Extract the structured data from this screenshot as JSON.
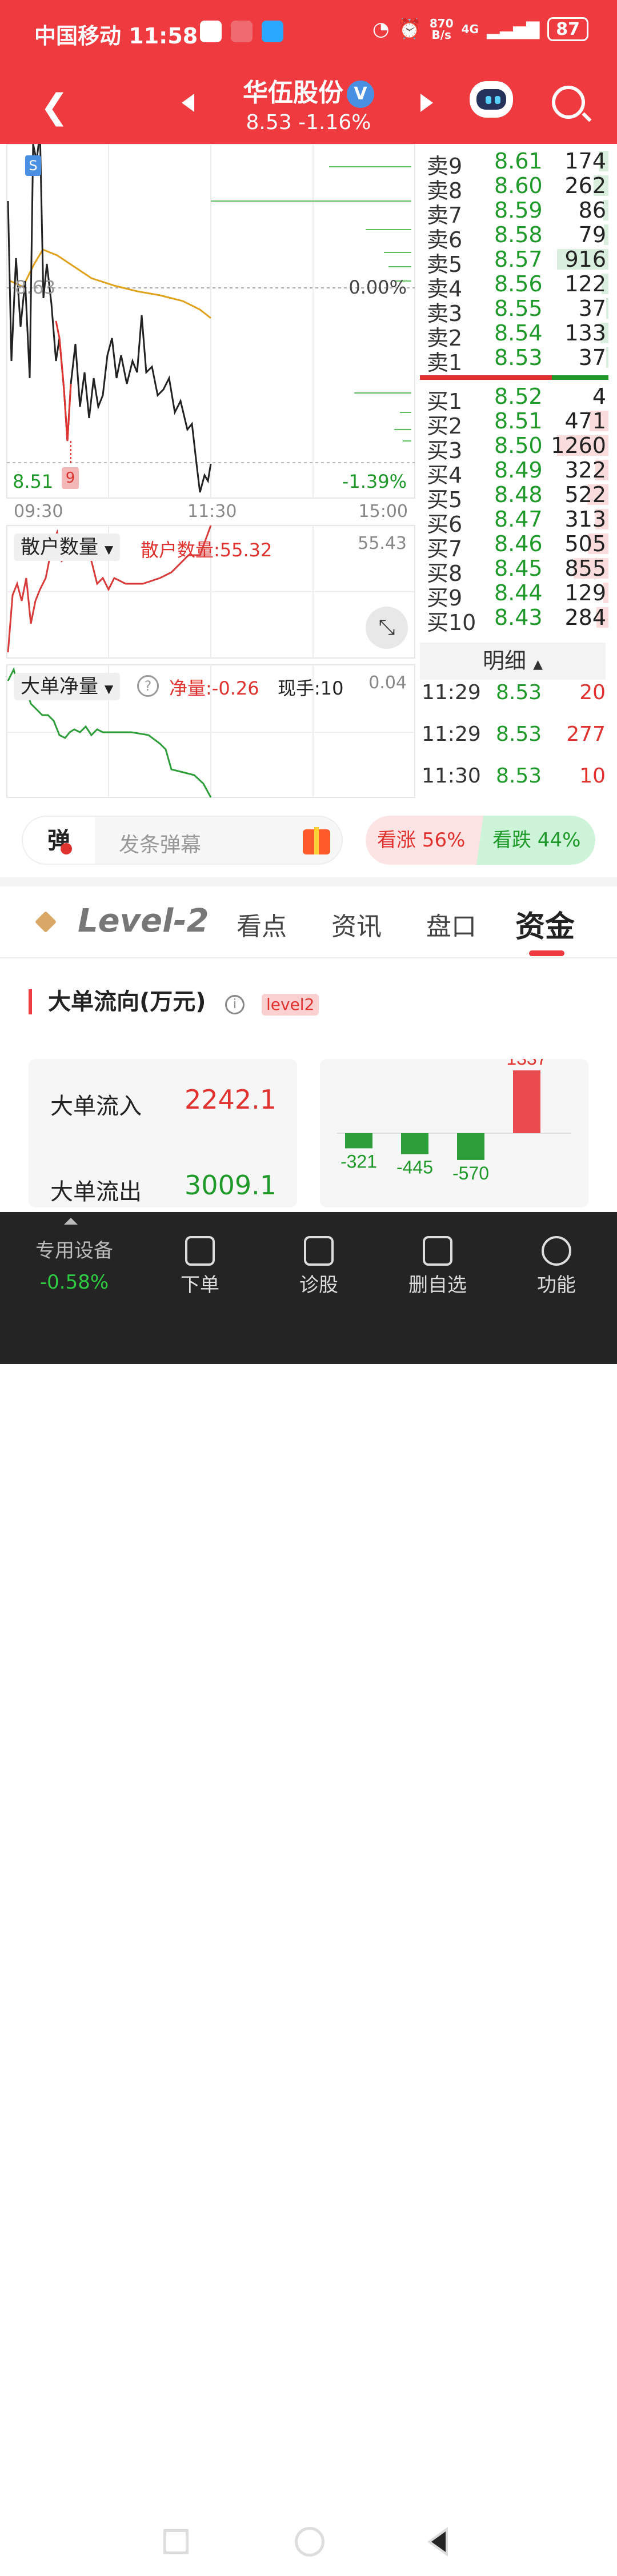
{
  "status_bar": {
    "carrier": "中国移动",
    "time": "11:58",
    "speed_value": "870",
    "speed_unit": "B/s",
    "network": "4G",
    "battery": "87"
  },
  "header": {
    "stock_name": "华伍股份",
    "verified_badge": "V",
    "price_line": "8.53 -1.16%",
    "back_icon": "chevron-left-icon",
    "prev_icon": "triangle-left-icon",
    "next_icon": "triangle-right-icon",
    "robot_icon": "robot-icon",
    "search_icon": "search-icon"
  },
  "chart": {
    "top_marker": "S",
    "ref_price": "8.63",
    "ref_pct": "0.00%",
    "low_price": "8.51",
    "low_marker": "9",
    "low_pct": "-1.39%",
    "times": [
      "09:30",
      "11:30",
      "15:00"
    ],
    "retail": {
      "selector": "散户数量",
      "label": "散户数量:55.32",
      "max": "55.43"
    },
    "bigorder": {
      "selector": "大单净量",
      "net_label": "净量:-0.26",
      "hand_label": "现手:10",
      "max": "0.04"
    },
    "expand_icon": "expand-icon",
    "help_icon": "question-icon"
  },
  "orderbook": {
    "asks": [
      {
        "name": "卖9",
        "price": "8.61",
        "vol": "174",
        "ratio": 0.19
      },
      {
        "name": "卖8",
        "price": "8.60",
        "vol": "262",
        "ratio": 0.29
      },
      {
        "name": "卖7",
        "price": "8.59",
        "vol": "86",
        "ratio": 0.1
      },
      {
        "name": "卖6",
        "price": "8.58",
        "vol": "79",
        "ratio": 0.09
      },
      {
        "name": "卖5",
        "price": "8.57",
        "vol": "916",
        "ratio": 1.0
      },
      {
        "name": "卖4",
        "price": "8.56",
        "vol": "122",
        "ratio": 0.13
      },
      {
        "name": "卖3",
        "price": "8.55",
        "vol": "37",
        "ratio": 0.04
      },
      {
        "name": "卖2",
        "price": "8.54",
        "vol": "133",
        "ratio": 0.15
      },
      {
        "name": "卖1",
        "price": "8.53",
        "vol": "37",
        "ratio": 0.04
      }
    ],
    "bids": [
      {
        "name": "买1",
        "price": "8.52",
        "vol": "4",
        "ratio": 0.0
      },
      {
        "name": "买2",
        "price": "8.51",
        "vol": "471",
        "ratio": 0.37
      },
      {
        "name": "买3",
        "price": "8.50",
        "vol": "1260",
        "ratio": 1.0
      },
      {
        "name": "买4",
        "price": "8.49",
        "vol": "322",
        "ratio": 0.26
      },
      {
        "name": "买5",
        "price": "8.48",
        "vol": "522",
        "ratio": 0.41
      },
      {
        "name": "买6",
        "price": "8.47",
        "vol": "313",
        "ratio": 0.25
      },
      {
        "name": "买7",
        "price": "8.46",
        "vol": "505",
        "ratio": 0.4
      },
      {
        "name": "买8",
        "price": "8.45",
        "vol": "855",
        "ratio": 0.68
      },
      {
        "name": "买9",
        "price": "8.44",
        "vol": "129",
        "ratio": 0.1
      },
      {
        "name": "买10",
        "price": "8.43",
        "vol": "284",
        "ratio": 0.23
      }
    ],
    "detail_label": "明细",
    "details": [
      {
        "time": "11:29",
        "price": "8.53",
        "vol": "20"
      },
      {
        "time": "11:29",
        "price": "8.53",
        "vol": "277"
      },
      {
        "time": "11:30",
        "price": "8.53",
        "vol": "10"
      }
    ]
  },
  "danmu": {
    "button": "弹",
    "placeholder": "发条弹幕",
    "gift_icon": "gift-icon"
  },
  "vote": {
    "up": "看涨 56%",
    "down": "看跌 44%"
  },
  "tabs": {
    "level": "Level-2",
    "items": [
      "看点",
      "资讯",
      "盘口",
      "资金"
    ],
    "active": "资金"
  },
  "capital": {
    "title": "大单流向(万元)",
    "tag": "level2",
    "inflow_label": "大单流入",
    "inflow_value": "2242.1",
    "outflow_label": "大单流出",
    "outflow_value": "3009.1"
  },
  "chart_data": {
    "type": "bar",
    "categories": [
      "",
      "",
      "",
      ""
    ],
    "values": [
      -321,
      -445,
      -570,
      1337
    ],
    "colors": [
      "#2e9e3a",
      "#2e9e3a",
      "#2e9e3a",
      "#e94b4f"
    ]
  },
  "bottom_nav": {
    "special_label": "专用设备",
    "special_change": "-0.58%",
    "items": [
      {
        "label": "下单",
        "icon": "order-icon"
      },
      {
        "label": "诊股",
        "icon": "diagnose-icon"
      },
      {
        "label": "删自选",
        "icon": "remove-watchlist-icon"
      },
      {
        "label": "功能",
        "icon": "menu-icon"
      }
    ]
  }
}
